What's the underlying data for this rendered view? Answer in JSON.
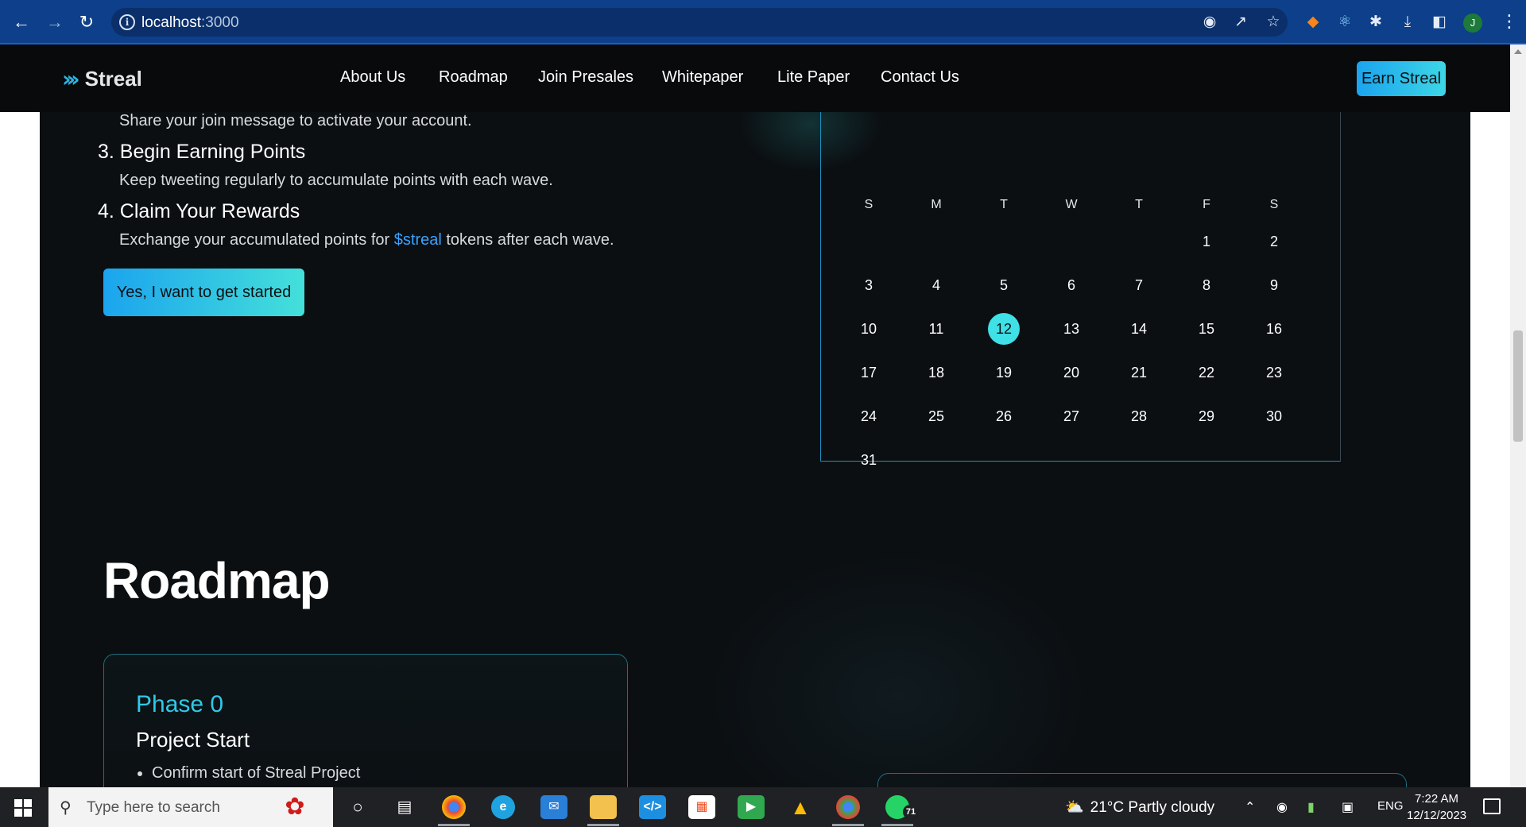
{
  "browser": {
    "url_host": "localhost",
    "url_port": ":3000",
    "profile_initial": "J"
  },
  "site": {
    "logo": "Streal",
    "nav_links": [
      "About Us",
      "Roadmap",
      "Join Presales",
      "Whitepaper",
      "Lite Paper",
      "Contact Us"
    ],
    "cta": "Earn Streal",
    "steps": {
      "step2_desc": "Share your join message to activate your account.",
      "step3_title": "3. Begin Earning Points",
      "step3_desc": "Keep tweeting regularly to accumulate points with each wave.",
      "step4_title": "4. Claim Your Rewards",
      "step4_desc_before": "Exchange your accumulated points for ",
      "step4_token": "$streal",
      "step4_desc_after": " tokens after each wave."
    },
    "start_button": "Yes, I want to get started",
    "calendar": {
      "weekdays": [
        "S",
        "M",
        "T",
        "W",
        "T",
        "F",
        "S"
      ],
      "first_weekday_index": 5,
      "days_in_month": 31,
      "selected_day": 12,
      "selected_color": "#3fe0e6"
    },
    "roadmap": {
      "title": "Roadmap",
      "phase_label": "Phase 0",
      "phase_title": "Project Start",
      "phase_items": [
        "Confirm start of Streal Project"
      ]
    }
  },
  "taskbar": {
    "search_placeholder": "Type here to search",
    "whatsapp_badge": "71",
    "weather": "21°C  Partly cloudy",
    "language": "ENG",
    "time": "7:22 AM",
    "date": "12/12/2023"
  },
  "colors": {
    "accent": "#2fc9e8",
    "button_gradient_start": "#1ba4ee",
    "button_gradient_end": "#44e0da",
    "link": "#3aa3ff",
    "site_background": "#0b0f12"
  }
}
